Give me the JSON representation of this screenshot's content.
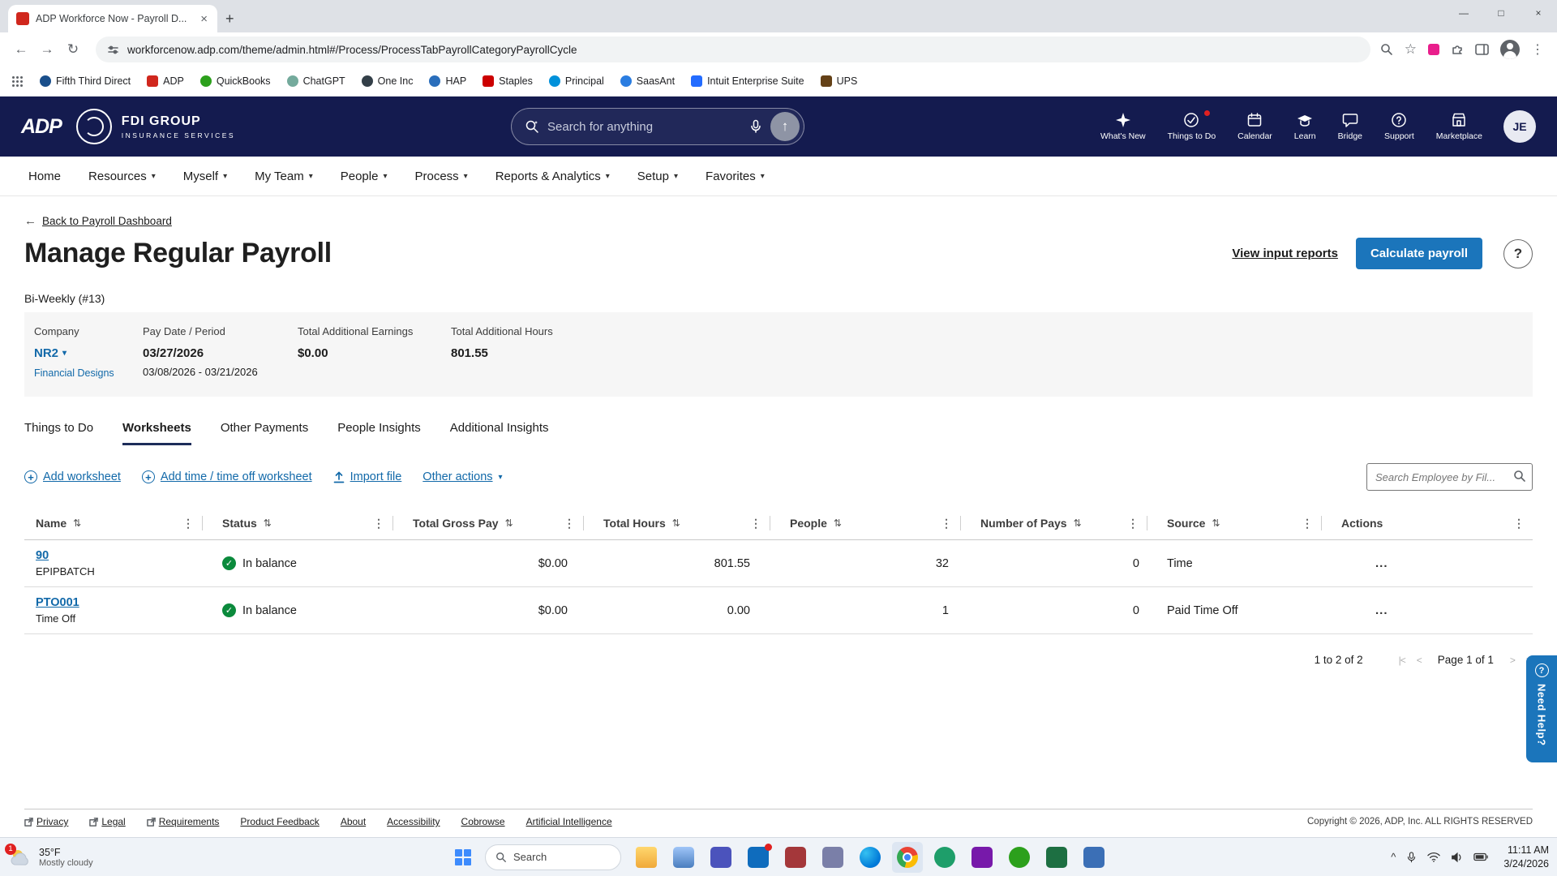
{
  "browser": {
    "tab_title": "ADP Workforce Now - Payroll D...",
    "url": "workforcenow.adp.com/theme/admin.html#/Process/ProcessTabPayrollCategoryPayrollCycle",
    "bookmarks": [
      {
        "label": "Fifth Third Direct",
        "color": "#1a4f8b"
      },
      {
        "label": "ADP",
        "color": "#d0271d"
      },
      {
        "label": "QuickBooks",
        "color": "#2ca01c"
      },
      {
        "label": "ChatGPT",
        "color": "#74aa9c"
      },
      {
        "label": "One Inc",
        "color": "#333f48"
      },
      {
        "label": "HAP",
        "color": "#2a6ebb"
      },
      {
        "label": "Staples",
        "color": "#cc0000"
      },
      {
        "label": "Principal",
        "color": "#0091da"
      },
      {
        "label": "SaasAnt",
        "color": "#2a7de1"
      },
      {
        "label": "Intuit Enterprise Suite",
        "color": "#236cff"
      },
      {
        "label": "UPS",
        "color": "#644117"
      }
    ]
  },
  "header": {
    "logo": "ADP",
    "company_name": "FDI GROUP",
    "company_tagline": "INSURANCE SERVICES",
    "search_placeholder": "Search for anything",
    "nav_icons": [
      {
        "label": "What's New"
      },
      {
        "label": "Things to Do"
      },
      {
        "label": "Calendar"
      },
      {
        "label": "Learn"
      },
      {
        "label": "Bridge"
      },
      {
        "label": "Support"
      },
      {
        "label": "Marketplace"
      }
    ],
    "avatar_initials": "JE"
  },
  "nav": {
    "items": [
      {
        "label": "Home"
      },
      {
        "label": "Resources"
      },
      {
        "label": "Myself"
      },
      {
        "label": "My Team"
      },
      {
        "label": "People"
      },
      {
        "label": "Process"
      },
      {
        "label": "Reports & Analytics"
      },
      {
        "label": "Setup"
      },
      {
        "label": "Favorites"
      }
    ]
  },
  "page": {
    "back_link": "Back to Payroll Dashboard",
    "title": "Manage Regular Payroll",
    "view_input_reports": "View input reports",
    "calculate_payroll": "Calculate payroll",
    "cycle": "Bi-Weekly (#13)"
  },
  "summary": {
    "company_label": "Company",
    "company_code": "NR2",
    "company_name_link": "Financial Designs",
    "pay_date_label": "Pay Date / Period",
    "pay_date": "03/27/2026",
    "pay_period": "03/08/2026 - 03/21/2026",
    "additional_earnings_label": "Total Additional Earnings",
    "additional_earnings": "$0.00",
    "additional_hours_label": "Total Additional Hours",
    "additional_hours": "801.55"
  },
  "tabs": [
    {
      "label": "Things to Do"
    },
    {
      "label": "Worksheets"
    },
    {
      "label": "Other Payments"
    },
    {
      "label": "People Insights"
    },
    {
      "label": "Additional Insights"
    }
  ],
  "toolbar": {
    "add_worksheet": "Add worksheet",
    "add_time_worksheet": "Add time / time off worksheet",
    "import_file": "Import file",
    "other_actions": "Other actions",
    "search_placeholder": "Search Employee by Fil..."
  },
  "table": {
    "columns": [
      {
        "label": "Name"
      },
      {
        "label": "Status"
      },
      {
        "label": "Total Gross Pay"
      },
      {
        "label": "Total Hours"
      },
      {
        "label": "People"
      },
      {
        "label": "Number of Pays"
      },
      {
        "label": "Source"
      },
      {
        "label": "Actions"
      }
    ],
    "rows": [
      {
        "name": "90",
        "subtitle": "EPIPBATCH",
        "status": "In balance",
        "gross": "$0.00",
        "hours": "801.55",
        "people": "32",
        "pays": "0",
        "source": "Time"
      },
      {
        "name": "PTO001",
        "subtitle": "Time Off",
        "status": "In balance",
        "gross": "$0.00",
        "hours": "0.00",
        "people": "1",
        "pays": "0",
        "source": "Paid Time Off"
      }
    ]
  },
  "pagination": {
    "range": "1 to 2 of 2",
    "page": "Page 1 of 1"
  },
  "footer": {
    "links": [
      {
        "label": "Privacy"
      },
      {
        "label": "Legal"
      },
      {
        "label": "Requirements"
      },
      {
        "label": "Product Feedback"
      },
      {
        "label": "About"
      },
      {
        "label": "Accessibility"
      },
      {
        "label": "Cobrowse"
      },
      {
        "label": "Artificial Intelligence"
      }
    ],
    "copyright": "Copyright © 2026, ADP, Inc. ALL RIGHTS RESERVED"
  },
  "help_tab": "Need Help?",
  "taskbar": {
    "weather_temp": "35°F",
    "weather_desc": "Mostly cloudy",
    "weather_badge": "1",
    "search_placeholder": "Search",
    "time": "11:11 AM",
    "date": "3/24/2026"
  },
  "icons": {
    "back_arrow": "←",
    "forward_arrow": "→",
    "reload": "↻",
    "star": "☆",
    "kebab": "⋮",
    "sort": "⇅",
    "caret": "▾",
    "check": "✓",
    "plus": "+",
    "question": "?",
    "up_arrow": "↑",
    "minimize": "—",
    "maximize": "□",
    "close": "×",
    "ellipsis": "...",
    "chevron_up": "^",
    "pager_first": "|<",
    "pager_prev": "<",
    "pager_next": ">",
    "pager_last": ">|"
  },
  "colors": {
    "navy": "#141b4f",
    "primary_blue": "#1b75bb",
    "link_blue": "#1269a9",
    "status_green": "#0b8a3c"
  }
}
